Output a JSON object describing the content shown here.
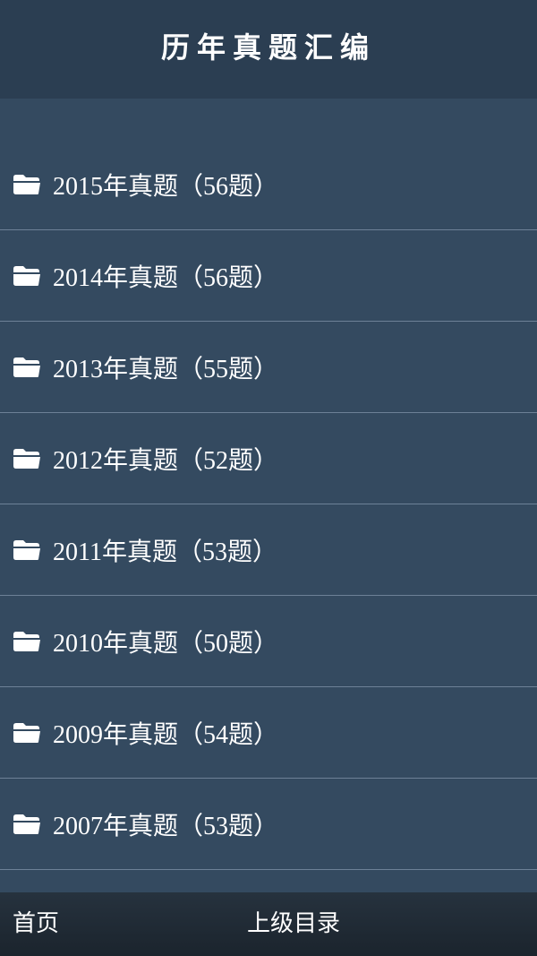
{
  "header": {
    "title": "历年真题汇编"
  },
  "items": [
    {
      "label": "2015年真题（56题）",
      "icon": "folder-icon"
    },
    {
      "label": "2014年真题（56题）",
      "icon": "folder-icon"
    },
    {
      "label": "2013年真题（55题）",
      "icon": "folder-icon"
    },
    {
      "label": "2012年真题（52题）",
      "icon": "folder-icon"
    },
    {
      "label": "2011年真题（53题）",
      "icon": "folder-icon"
    },
    {
      "label": "2010年真题（50题）",
      "icon": "folder-icon"
    },
    {
      "label": "2009年真题（54题）",
      "icon": "folder-icon"
    },
    {
      "label": "2007年真题（53题）",
      "icon": "folder-icon"
    }
  ],
  "footer": {
    "home_label": "首页",
    "up_label": "上级目录"
  },
  "colors": {
    "background": "#344a60",
    "header": "#2b3e52",
    "footer": "#1f2a35",
    "divider": "#6d8197",
    "text": "#ffffff"
  }
}
